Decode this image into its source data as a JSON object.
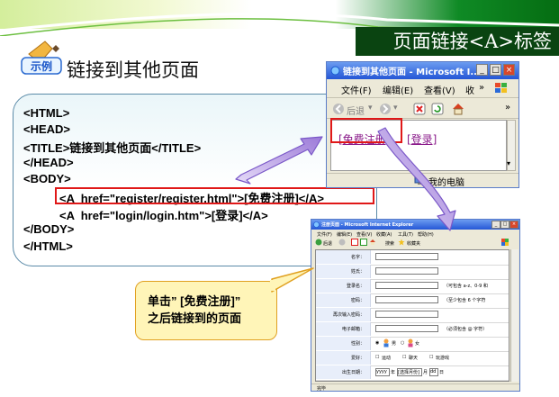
{
  "slide": {
    "title": "页面链接<A>标签",
    "badge_text": "示例",
    "heading": "链接到其他页面"
  },
  "code_lines": [
    "<HTML>",
    "<HEAD>",
    "<TITLE>链接到其他页面</TITLE>",
    "</HEAD>",
    "<BODY>",
    "<A  href=\"register/register.html\">[免费注册]</A>",
    "<A  href=\"login/login.htm\">[登录]</A>",
    "</BODY>",
    "</HTML>"
  ],
  "browser_small": {
    "title": "链接到其他页面 - Microsoft I...",
    "menu": [
      "文件(F)",
      "编辑(E)",
      "查看(V)",
      "收"
    ],
    "back_label": "后退",
    "links": [
      "[免费注册]",
      "[登录]"
    ],
    "status": "我的电脑"
  },
  "browser_large": {
    "title": "注册页面 - Microsoft Internet Explorer",
    "menu": [
      "文件(F)",
      "编辑(E)",
      "查看(V)",
      "收藏(A)",
      "工具(T)",
      "帮助(H)"
    ],
    "toolbar": [
      "后退",
      "搜索",
      "收藏夹"
    ],
    "status": "完毕",
    "form_rows": [
      {
        "label": "名字：",
        "hint": ""
      },
      {
        "label": "姓氏：",
        "hint": ""
      },
      {
        "label": "登录名：",
        "hint": "（可包含 a-z、0-9 和"
      },
      {
        "label": "密码：",
        "hint": "（至少包含 6 个字符"
      },
      {
        "label": "再次输入密码：",
        "hint": ""
      },
      {
        "label": "电子邮箱：",
        "hint": "（必须包含 @ 字符）"
      },
      {
        "label": "性别：",
        "options": [
          "男",
          "女"
        ]
      },
      {
        "label": "爱好：",
        "options": [
          "运动",
          "聊天",
          "玩游戏"
        ]
      },
      {
        "label": "出生日期：",
        "year": "yyyy",
        "year_unit": "年",
        "month": "[选择月份]",
        "month_unit": "月",
        "day": "dd",
        "day_unit": "日"
      }
    ]
  },
  "callout": {
    "line1": "单击” [免费注册]”",
    "line2": "之后链接到的页面"
  },
  "colors": {
    "title_bar": "#0a4411",
    "highlight": "#e01818",
    "arrow": "#b090e0",
    "callout_fill": "#fff5b8"
  }
}
